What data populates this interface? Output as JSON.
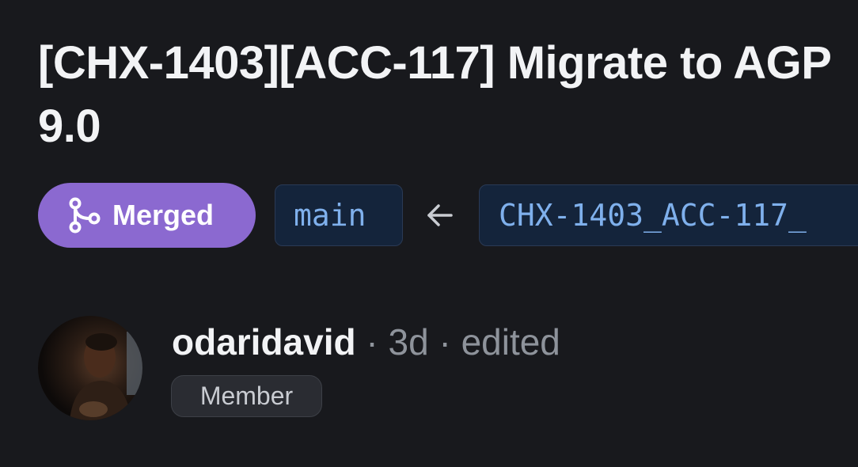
{
  "pull_request": {
    "title": "[CHX-1403][ACC-117] Migrate to AGP 9.0",
    "status": {
      "label": "Merged",
      "icon": "git-merge-icon",
      "color": "#8b69d0"
    },
    "base_branch": "main",
    "arrow_icon": "arrow-left-icon",
    "head_branch": "CHX-1403_ACC-117_"
  },
  "author": {
    "username": "odaridavid",
    "separator": " · ",
    "age": "3d",
    "edited": "edited",
    "role": "Member",
    "avatar_icon": "user-avatar"
  }
}
